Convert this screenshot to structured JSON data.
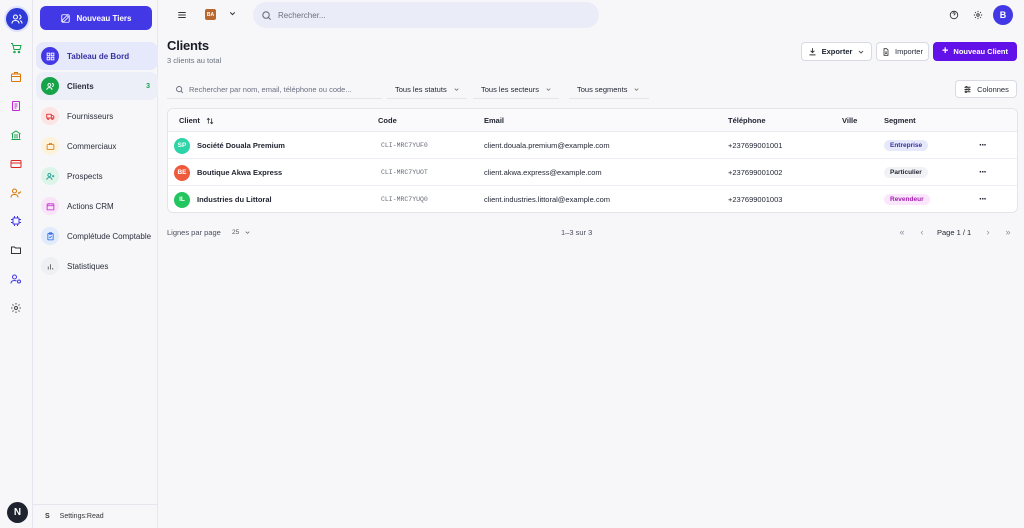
{
  "colors": {
    "primary": "#4338e6",
    "accent_purple": "#6211e8",
    "success": "#16a34a"
  },
  "rail": {
    "icons": [
      "users-icon",
      "cart-icon",
      "box-icon",
      "document-icon",
      "bank-icon",
      "card-icon",
      "user-check-icon",
      "chip-icon",
      "folder-icon",
      "user-gear-icon",
      "gear-icon"
    ],
    "bottom_avatar": "N"
  },
  "sidebar": {
    "new_button": "Nouveau Tiers",
    "items": [
      {
        "label": "Tableau de Bord",
        "icon": "grid-icon"
      },
      {
        "label": "Clients",
        "icon": "users-icon",
        "count": "3"
      },
      {
        "label": "Fournisseurs",
        "icon": "truck-icon"
      },
      {
        "label": "Commerciaux",
        "icon": "briefcase-icon"
      },
      {
        "label": "Prospects",
        "icon": "user-plus-icon"
      },
      {
        "label": "Actions CRM",
        "icon": "calendar-icon"
      },
      {
        "label": "Complétude Comptable",
        "icon": "clipboard-icon"
      },
      {
        "label": "Statistiques",
        "icon": "bar-chart-icon"
      }
    ],
    "footer_initial": "S",
    "footer_text": "Settings:Read"
  },
  "header": {
    "org_badge": "BA",
    "search_placeholder": "Rechercher...",
    "user_initial": "B"
  },
  "main": {
    "title": "Clients",
    "subtitle": "3 clients au total",
    "export_label": "Exporter",
    "import_label": "Importer",
    "new_client_label": "Nouveau Client",
    "filter_search_placeholder": "Rechercher par nom, email, téléphone ou code...",
    "filters": [
      "Tous les statuts",
      "Tous les secteurs",
      "Tous segments"
    ],
    "columns_button": "Colonnes",
    "table": {
      "headers": [
        "Client",
        "Code",
        "Email",
        "Téléphone",
        "Ville",
        "Segment"
      ],
      "rows": [
        {
          "initials": "SP",
          "avatar_color": "#2dd4a7",
          "name": "Société Douala Premium",
          "code": "CLI-MRC7YUF0",
          "email": "client.douala.premium@example.com",
          "phone": "+237699001001",
          "city": "",
          "segment": "Entreprise",
          "segment_bg": "#e6e9fb",
          "segment_fg": "#3730a3"
        },
        {
          "initials": "BE",
          "avatar_color": "#ef5a3c",
          "name": "Boutique Akwa Express",
          "code": "CLI-MRC7YUOT",
          "email": "client.akwa.express@example.com",
          "phone": "+237699001002",
          "city": "",
          "segment": "Particulier",
          "segment_bg": "#f1f2f5",
          "segment_fg": "#1f2330"
        },
        {
          "initials": "IL",
          "avatar_color": "#22c55e",
          "name": "Industries du Littoral",
          "code": "CLI-MRC7YUQ0",
          "email": "client.industries.littoral@example.com",
          "phone": "+237699001003",
          "city": "",
          "segment": "Revendeur",
          "segment_bg": "#fbe7fb",
          "segment_fg": "#a21caf"
        }
      ]
    },
    "pagination": {
      "rows_label": "Lignes par page",
      "page_size": "25",
      "range": "1–3 sur 3",
      "page_label": "Page 1 / 1"
    }
  }
}
